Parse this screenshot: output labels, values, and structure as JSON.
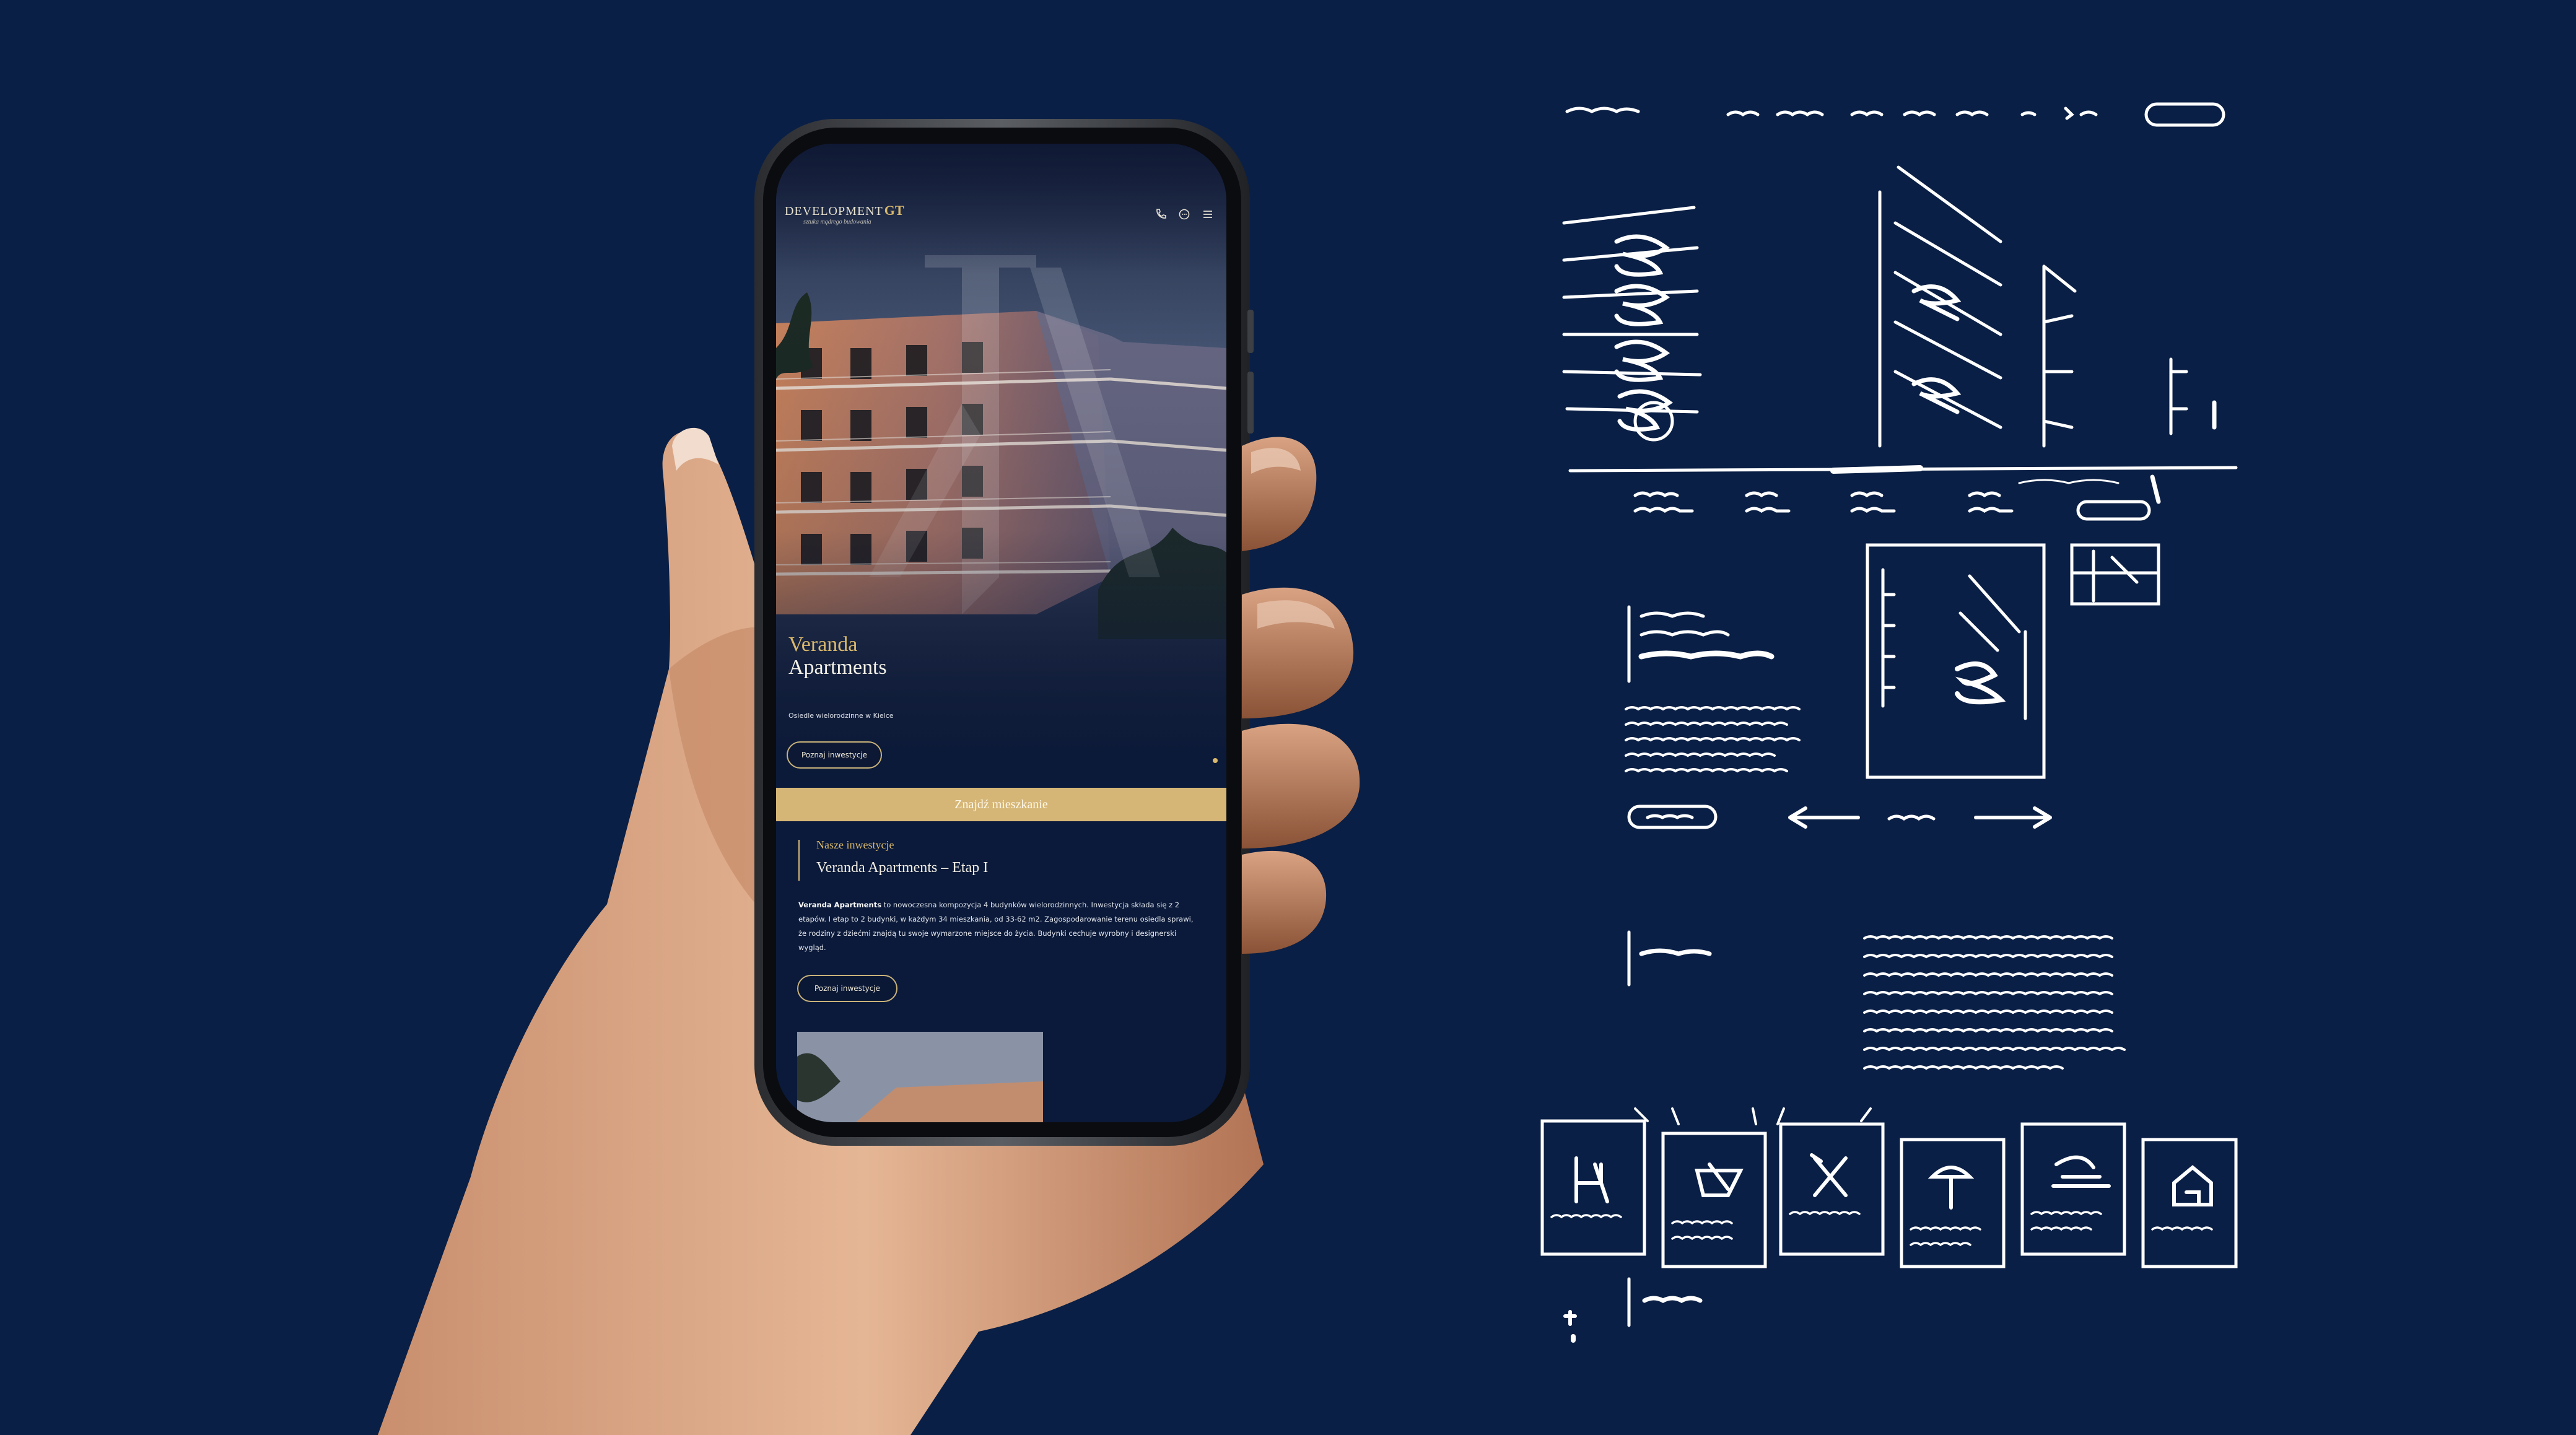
{
  "mockup": {
    "phone_site": {
      "logo": {
        "text": "DEVELOPMENT",
        "mark": "GT",
        "tagline": "sztuka mądrego budowania"
      },
      "header_icons": [
        "phone-icon",
        "chat-icon",
        "menu-icon"
      ],
      "hero": {
        "title_line1": "Veranda",
        "title_line2": "Apartments",
        "subtitle": "Osiedle wielorodzinne w Kielce",
        "button_label": "Poznaj inwestycje"
      },
      "cta_bar_label": "Znajdź mieszkanie",
      "investments": {
        "kicker": "Nasze inwestycje",
        "title": "Veranda Apartments – Etap I",
        "description_bold": "Veranda Apartments",
        "description": " to nowoczesna kompozycja 4 budynków wielorodzinnych. Inwestycja składa się z 2 etapów. I etap to 2 budynki, w każdym 34 mieszkania, od 33-62 m2. Zagospodarowanie terenu osiedla sprawi, że rodziny z dziećmi znajdą tu swoje wymarzone miejsce do życia. Budynki cechuje wyrobny i designerski wygląd.",
        "button_label": "Poznaj inwestycje"
      }
    },
    "wireframe_sketch": {
      "annotations": [
        "wizualizacja!",
        "ruchome?",
        "lista rozwijana",
        "galeria!",
        "galeria 2",
        "strzałki",
        "opisy + symbole"
      ]
    },
    "colors": {
      "background": "#0a1f45",
      "gold_accent": "#d6b677",
      "screen_bg": "#0b1a3a",
      "sketch_ink": "#ffffff"
    }
  }
}
